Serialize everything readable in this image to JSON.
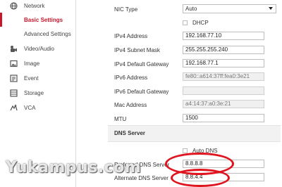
{
  "sidebar": {
    "items": [
      {
        "label": "Network",
        "icon": "globe-icon"
      },
      {
        "label": "Basic Settings",
        "active": true
      },
      {
        "label": "Advanced Settings"
      },
      {
        "label": "Video/Audio",
        "icon": "video-audio-icon"
      },
      {
        "label": "Image",
        "icon": "image-icon"
      },
      {
        "label": "Event",
        "icon": "event-icon"
      },
      {
        "label": "Storage",
        "icon": "storage-icon"
      },
      {
        "label": "VCA",
        "icon": "vca-icon"
      }
    ],
    "accent_color": "#c8162b"
  },
  "form": {
    "nic_type": {
      "label": "NIC Type",
      "value": "Auto"
    },
    "dhcp": {
      "label": "DHCP",
      "checked": false
    },
    "ipv4_address": {
      "label": "IPv4 Address",
      "value": "192.168.77.10"
    },
    "ipv4_mask": {
      "label": "IPv4 Subnet Mask",
      "value": "255.255.255.240"
    },
    "ipv4_gateway": {
      "label": "IPv4 Default Gateway",
      "value": "192.168.77.1"
    },
    "ipv6_address": {
      "label": "IPv6 Address",
      "value": "fe80::a614:37ff:fea0:3e21"
    },
    "ipv6_gateway": {
      "label": "IPv6 Default Gateway",
      "value": ""
    },
    "mac_address": {
      "label": "Mac Address",
      "value": "a4:14:37:a0:3e:21"
    },
    "mtu": {
      "label": "MTU",
      "value": "1500"
    }
  },
  "dns": {
    "section_title": "DNS Server",
    "auto_dns": {
      "label": "Auto DNS",
      "checked": false
    },
    "preferred": {
      "label": "Preferred DNS Server",
      "value": "8.8.8.8"
    },
    "alternate": {
      "label": "Alternate DNS Server",
      "value": "8.8.4.4"
    },
    "highlight_color": "#e0141e"
  },
  "watermark": "Yukampus.com"
}
